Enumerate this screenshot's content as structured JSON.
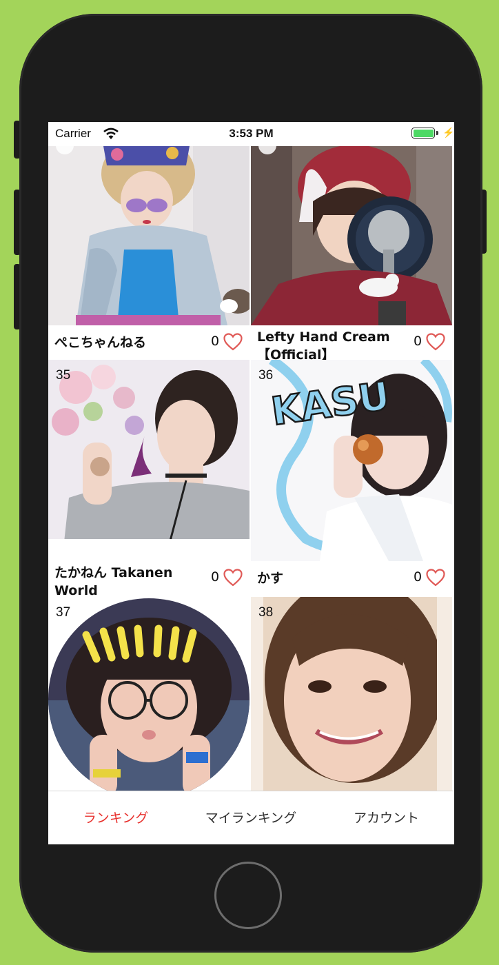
{
  "status_bar": {
    "carrier": "Carrier",
    "time": "3:53 PM"
  },
  "items": [
    {
      "rank": "",
      "name": "ぺこちゃんねる",
      "likes": "0",
      "photo": "photo-pink-hair-woman"
    },
    {
      "rank": "",
      "name": "Lefty Hand Cream【Official】",
      "likes": "0",
      "photo": "photo-woman-microphone"
    },
    {
      "rank": "35",
      "name": "たかねん Takanen World",
      "likes": "0",
      "photo": "photo-woman-flowers"
    },
    {
      "rank": "36",
      "name": "かす",
      "likes": "0",
      "photo": "photo-kasu-girl"
    },
    {
      "rank": "37",
      "name": "",
      "likes": "",
      "photo": "photo-glasses-girl-circle"
    },
    {
      "rank": "38",
      "name": "",
      "likes": "",
      "photo": "photo-smiling-woman"
    }
  ],
  "overlay_text": {
    "kasu_title": "KASU"
  },
  "tabs": [
    {
      "label": "ランキング",
      "active": true
    },
    {
      "label": "マイランキング",
      "active": false
    },
    {
      "label": "アカウント",
      "active": false
    }
  ],
  "colors": {
    "accent": "#e8332f",
    "heart": "#e05a57",
    "background": "#a3d45a",
    "battery": "#4cd964"
  }
}
